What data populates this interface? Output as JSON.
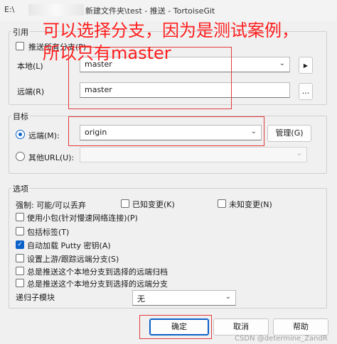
{
  "window": {
    "title_prefix": "E:\\",
    "title_rest": "新建文件夹\\test - 推送 - TortoiseGit"
  },
  "annotation": {
    "line1": "可以选择分支，因为是测试案例，",
    "line2": "所以只有master",
    "color": "#ff1e1e"
  },
  "refs": {
    "group_label": "引用",
    "push_all_label": "推送所有分支(P)",
    "local_label": "本地(L)",
    "local_value": "master",
    "local_btn": "▶",
    "remote_label": "远端(R)",
    "remote_value": "master",
    "remote_btn": "..."
  },
  "target": {
    "group_label": "目标",
    "remote_radio_label": "远端(M):",
    "remote_value": "origin",
    "manage_btn": "管理(G)",
    "url_radio_label": "其他URL(U):",
    "url_value": ""
  },
  "options": {
    "group_label": "选项",
    "force_label": "强制: 可能/可以丢弃",
    "known_changes_label": "已知变更(K)",
    "unknown_changes_label": "未知变更(N)",
    "thin_pack_label": "使用小包(针对慢速网络连接)(P)",
    "include_tags_label": "包括标签(T)",
    "autoload_putty_label": "自动加载 Putty 密钥(A)",
    "set_upstream_label": "设置上游/跟踪远端分支(S)",
    "always_push_archive_label": "总是推送这个本地分支到选择的远端归档",
    "always_push_branch_label": "总是推送这个本地分支到选择的远端分支",
    "recurse_label": "递归子模块",
    "recurse_value": "无"
  },
  "buttons": {
    "ok": "确定",
    "cancel": "取消",
    "help": "帮助"
  },
  "watermark": "CSDN @determine_ZandR"
}
